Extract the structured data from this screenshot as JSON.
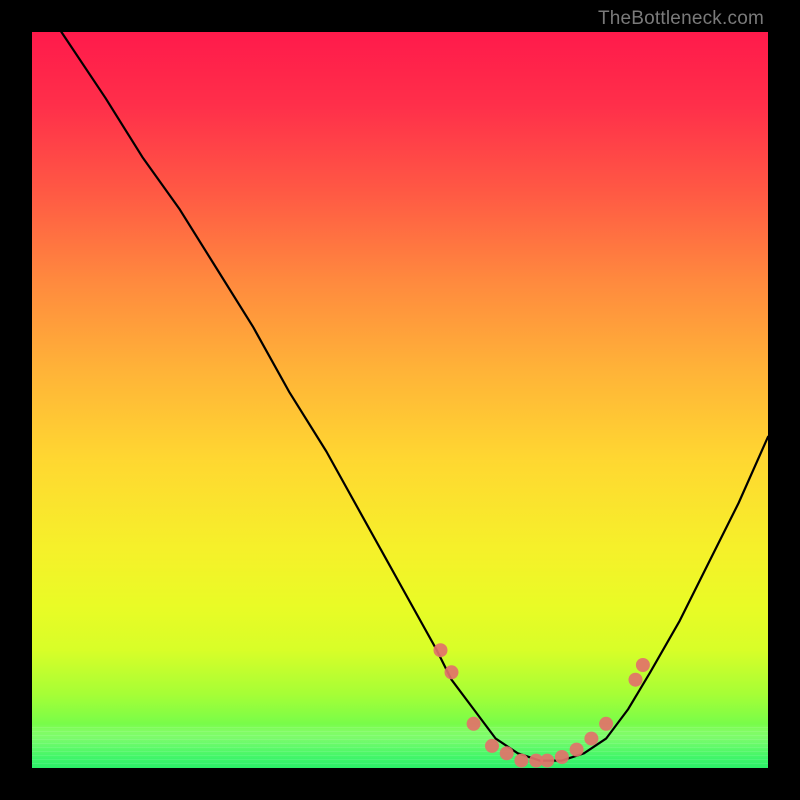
{
  "watermark": "TheBottleneck.com",
  "chart_data": {
    "type": "line",
    "title": "",
    "xlabel": "",
    "ylabel": "",
    "x_range": [
      0,
      100
    ],
    "y_range": [
      0,
      100
    ],
    "series": [
      {
        "name": "bottleneck-curve",
        "x": [
          4,
          10,
          15,
          20,
          25,
          30,
          35,
          40,
          45,
          50,
          55,
          57,
          60,
          63,
          66,
          69,
          72,
          75,
          78,
          81,
          84,
          88,
          92,
          96,
          100
        ],
        "y": [
          100,
          91,
          83,
          76,
          68,
          60,
          51,
          43,
          34,
          25,
          16,
          12,
          8,
          4,
          2,
          1,
          1,
          2,
          4,
          8,
          13,
          20,
          28,
          36,
          45
        ]
      }
    ],
    "markers": {
      "name": "valley-markers",
      "color": "#e2726a",
      "points": [
        {
          "x": 55.5,
          "y": 16
        },
        {
          "x": 57.0,
          "y": 13
        },
        {
          "x": 60.0,
          "y": 6
        },
        {
          "x": 62.5,
          "y": 3
        },
        {
          "x": 64.5,
          "y": 2
        },
        {
          "x": 66.5,
          "y": 1
        },
        {
          "x": 68.5,
          "y": 1
        },
        {
          "x": 70.0,
          "y": 1
        },
        {
          "x": 72.0,
          "y": 1.5
        },
        {
          "x": 74.0,
          "y": 2.5
        },
        {
          "x": 76.0,
          "y": 4
        },
        {
          "x": 78.0,
          "y": 6
        },
        {
          "x": 82.0,
          "y": 12
        },
        {
          "x": 83.0,
          "y": 14
        }
      ]
    },
    "gradient_stops": [
      {
        "pct": 0,
        "color": "#ff1a4b"
      },
      {
        "pct": 50,
        "color": "#ffd731"
      },
      {
        "pct": 80,
        "color": "#e9fb26"
      },
      {
        "pct": 100,
        "color": "#2ef26c"
      }
    ]
  }
}
